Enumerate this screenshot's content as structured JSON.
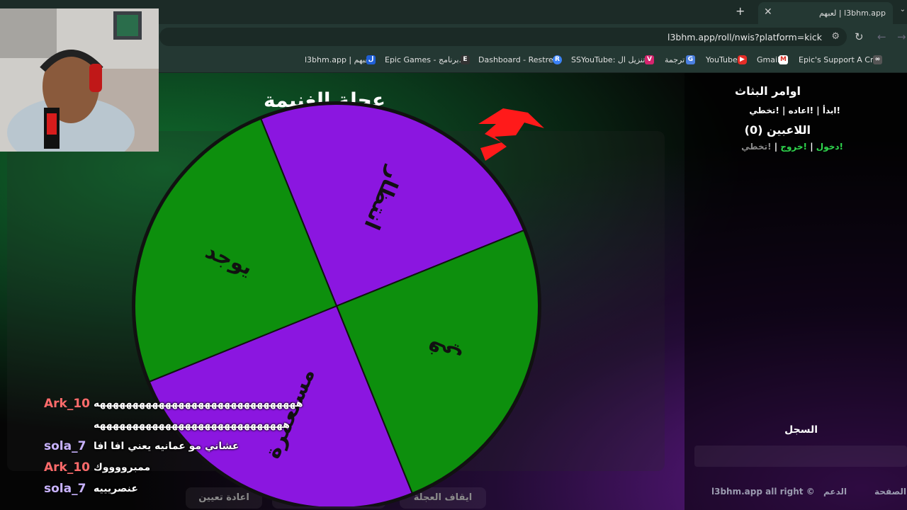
{
  "browser": {
    "tab_title": "l3bhm.app | لعبهم",
    "url": "l3bhm.app/roll/nwis?platform=kick",
    "bookmarks": [
      "l3bhm.app | لعبهم",
      "Epic Games - برنامج...",
      "Dashboard - Restre...",
      "SSYouTube: تنزيل ال...",
      "ترجمة",
      "YouTube",
      "Gmail",
      "Epic's Support A Cr..."
    ]
  },
  "page": {
    "wheel_title": "عجلة الغنيمة",
    "sidebar": {
      "title": "اوامر البثاث",
      "commands": "!ابدأ | !اعاده | !تخطي",
      "players": "اللاعبين (0)",
      "join": "!دخول",
      "sep1": "|",
      "leave": "!خروج",
      "sep2": "|",
      "skip": "!تخطي",
      "log_title": "السجل",
      "footer_copy": "l3bhm.app all right ©",
      "footer_support": "الدعم",
      "footer_page": "الصفحة"
    },
    "buttons": {
      "reset": "اعادة تعيين",
      "stop": "ايقاف العجلة"
    }
  },
  "wheel": {
    "segments": [
      {
        "label": "انتظار",
        "color": "#8b16e0"
      },
      {
        "label": "في",
        "color": "#0d8f0d"
      },
      {
        "label": "مستعمرة",
        "color": "#8b16e0"
      },
      {
        "label": "يوجد",
        "color": "#0d8f0d"
      }
    ],
    "pointer_color": "#ff1a1a"
  },
  "chat": [
    {
      "user": "Ark_10",
      "msg": "هههههههههههههههههههههههههههههههه",
      "user_color": "#ff6b6b"
    },
    {
      "user": "",
      "msg": "هههههههههههههههههههههههههههههه",
      "user_color": "#ff6b6b"
    },
    {
      "user": "sola_7",
      "msg": "عشاني مو عمانيه يعني افا افا",
      "user_color": "#c9b3ff"
    },
    {
      "user": "Ark_10",
      "msg": "ممبرووووك",
      "user_color": "#ff6b6b"
    },
    {
      "user": "sola_7",
      "msg": "عنصريييه",
      "user_color": "#c9b3ff"
    }
  ]
}
